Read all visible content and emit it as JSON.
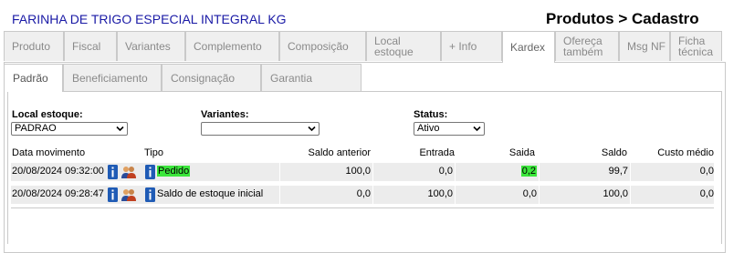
{
  "header": {
    "product_name": "FARINHA DE TRIGO ESPECIAL INTEGRAL KG",
    "page_title": "Produtos > Cadastro"
  },
  "tabs": [
    "Produto",
    "Fiscal",
    "Variantes",
    "Complemento",
    "Composição",
    "Local estoque",
    "+ Info",
    "Kardex",
    "Ofereça também",
    "Msg NF",
    "Ficha técnica"
  ],
  "active_tab": "Kardex",
  "subtabs": [
    "Padrão",
    "Beneficiamento",
    "Consignação",
    "Garantia"
  ],
  "active_subtab": "Padrão",
  "filters": {
    "local_label": "Local estoque:",
    "local_value": "PADRAO",
    "variantes_label": "Variantes:",
    "variantes_value": "",
    "status_label": "Status:",
    "status_value": "Ativo"
  },
  "table": {
    "columns": [
      "Data movimento",
      "Tipo",
      "Saldo anterior",
      "Entrada",
      "Saida",
      "Saldo",
      "Custo médio"
    ],
    "rows": [
      {
        "data": "20/08/2024 09:32:00",
        "tipo": "Pedido",
        "saldo_anterior": "100,0",
        "entrada": "0,0",
        "saida": "0,2",
        "saldo": "99,7",
        "custo_medio": "0,0"
      },
      {
        "data": "20/08/2024 09:28:47",
        "tipo": "Saldo de estoque inicial",
        "saldo_anterior": "0,0",
        "entrada": "100,0",
        "saida": "0,0",
        "saldo": "100,0",
        "custo_medio": "0,0"
      }
    ]
  },
  "colors": {
    "title_blue": "#1a1aa6",
    "highlight_green": "#3be63b",
    "icon_blue": "#1f5bb5"
  }
}
